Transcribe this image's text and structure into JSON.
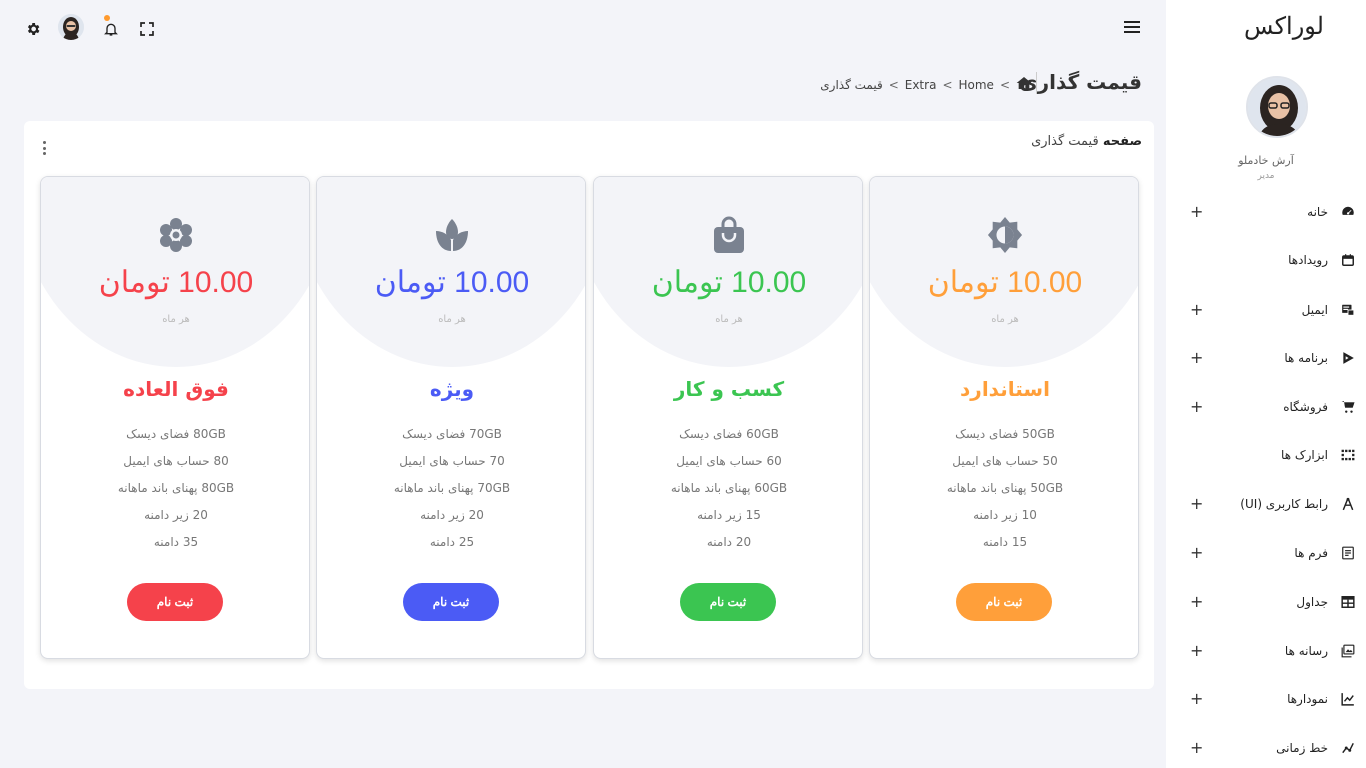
{
  "sidebar": {
    "brand": "لوراکس",
    "profile": {
      "name": "آرش خادملو",
      "role": "مدیر"
    },
    "items": [
      {
        "label": "خانه",
        "icon": "dashboard-icon",
        "expandable": true
      },
      {
        "label": "رویدادها",
        "icon": "calendar-icon",
        "expandable": false
      },
      {
        "label": "ایمیل",
        "icon": "email-icon",
        "expandable": true
      },
      {
        "label": "برنامه ها",
        "icon": "apps-icon",
        "expandable": true
      },
      {
        "label": "فروشگاه",
        "icon": "cart-icon",
        "expandable": true
      },
      {
        "label": "ابزارک ها",
        "icon": "widgets-icon",
        "expandable": false
      },
      {
        "label": "رابط کاربری (UI)",
        "icon": "ui-icon",
        "expandable": true
      },
      {
        "label": "فرم ها",
        "icon": "form-icon",
        "expandable": true
      },
      {
        "label": "جداول",
        "icon": "table-icon",
        "expandable": true
      },
      {
        "label": "رسانه ها",
        "icon": "media-icon",
        "expandable": true
      },
      {
        "label": "نمودارها",
        "icon": "chart-icon",
        "expandable": true
      },
      {
        "label": "خط زمانی",
        "icon": "timeline-icon",
        "expandable": true
      }
    ],
    "plus_label": "+"
  },
  "header": {
    "page_title": "قیمت گذاری",
    "breadcrumb": [
      "Home",
      "Extra",
      "قیمت گذاری"
    ],
    "breadcrumb_sep": ">"
  },
  "card": {
    "title_bold": "صفحه",
    "title_rest": " قیمت گذاری"
  },
  "plans": [
    {
      "name": "استاندارد",
      "price": "10.00 تومان",
      "period": "هر ماه",
      "color": "#ff9f3a",
      "icon": "contrast-icon",
      "features": [
        "50GB فضای دیسک",
        "50 حساب های ایمیل",
        "50GB پهنای باند ماهانه",
        "10 زیر دامنه",
        "15 دامنه"
      ],
      "button": "ثبت نام"
    },
    {
      "name": "کسب و کار",
      "price": "10.00 تومان",
      "period": "هر ماه",
      "color": "#3bc551",
      "icon": "shopping-bag-icon",
      "features": [
        "60GB فضای دیسک",
        "60 حساب های ایمیل",
        "60GB پهنای باند ماهانه",
        "15 زیر دامنه",
        "20 دامنه"
      ],
      "button": "ثبت نام"
    },
    {
      "name": "ویژه",
      "price": "10.00 تومان",
      "period": "هر ماه",
      "color": "#4b5bf5",
      "icon": "spa-icon",
      "features": [
        "70GB فضای دیسک",
        "70 حساب های ایمیل",
        "70GB پهنای باند ماهانه",
        "20 زیر دامنه",
        "25 دامنه"
      ],
      "button": "ثبت نام"
    },
    {
      "name": "فوق العاده",
      "price": "10.00 تومان",
      "period": "هر ماه",
      "color": "#f5424b",
      "icon": "flower-icon",
      "features": [
        "80GB فضای دیسک",
        "80 حساب های ایمیل",
        "80GB پهنای باند ماهانه",
        "20 زیر دامنه",
        "35 دامنه"
      ],
      "button": "ثبت نام"
    }
  ]
}
